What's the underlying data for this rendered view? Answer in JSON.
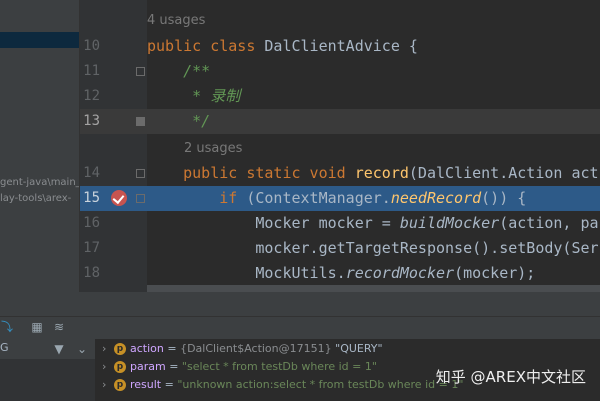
{
  "project_tree": {
    "paths": [
      "gent-java\\main_",
      "lay-tools\\arex-"
    ]
  },
  "editor": {
    "usage_top": "4 usages",
    "usage_method": "2 usages",
    "lines": [
      {
        "num": "10",
        "parts": [
          [
            "kw",
            "public "
          ],
          [
            "kw",
            "class "
          ],
          [
            "cls",
            "DalClientAdvice {"
          ]
        ]
      },
      {
        "num": "11",
        "parts": [
          [
            "cmt",
            "    /**"
          ]
        ]
      },
      {
        "num": "12",
        "parts": [
          [
            "cmt",
            "     * 录制"
          ]
        ]
      },
      {
        "num": "13",
        "parts": [
          [
            "cmt",
            "     */"
          ]
        ]
      },
      {
        "num": "14",
        "parts": [
          [
            "kw",
            "    public static void "
          ],
          [
            "fn",
            "record"
          ],
          [
            "cls",
            "(DalClient.Action act"
          ]
        ]
      },
      {
        "num": "15",
        "parts": [
          [
            "kw",
            "        if "
          ],
          [
            "cls",
            "(ContextManager."
          ],
          [
            "fnit",
            "needRecord"
          ],
          [
            "cls",
            "()) {"
          ]
        ]
      },
      {
        "num": "16",
        "parts": [
          [
            "cls",
            "            Mocker mocker = "
          ],
          [
            "it",
            "buildMocker"
          ],
          [
            "cls",
            "(action, pa"
          ]
        ]
      },
      {
        "num": "17",
        "parts": [
          [
            "cls",
            "            mocker.getTargetResponse().setBody(Ser"
          ]
        ]
      },
      {
        "num": "18",
        "parts": [
          [
            "cls",
            "            MockUtils."
          ],
          [
            "it",
            "recordMocker"
          ],
          [
            "cls",
            "(mocker);"
          ]
        ]
      }
    ]
  },
  "debugger": {
    "frames_label": "G",
    "variables": [
      {
        "name": "action",
        "ref": "{DalClient$Action@17151}",
        "value": "\"QUERY\""
      },
      {
        "name": "param",
        "ref": "",
        "value": "\"select * from testDb where id = 1\""
      },
      {
        "name": "result",
        "ref": "",
        "value": "\"unknown action:select * from testDb where id = 1\""
      }
    ]
  },
  "watermark": "知乎 @AREX中文社区"
}
